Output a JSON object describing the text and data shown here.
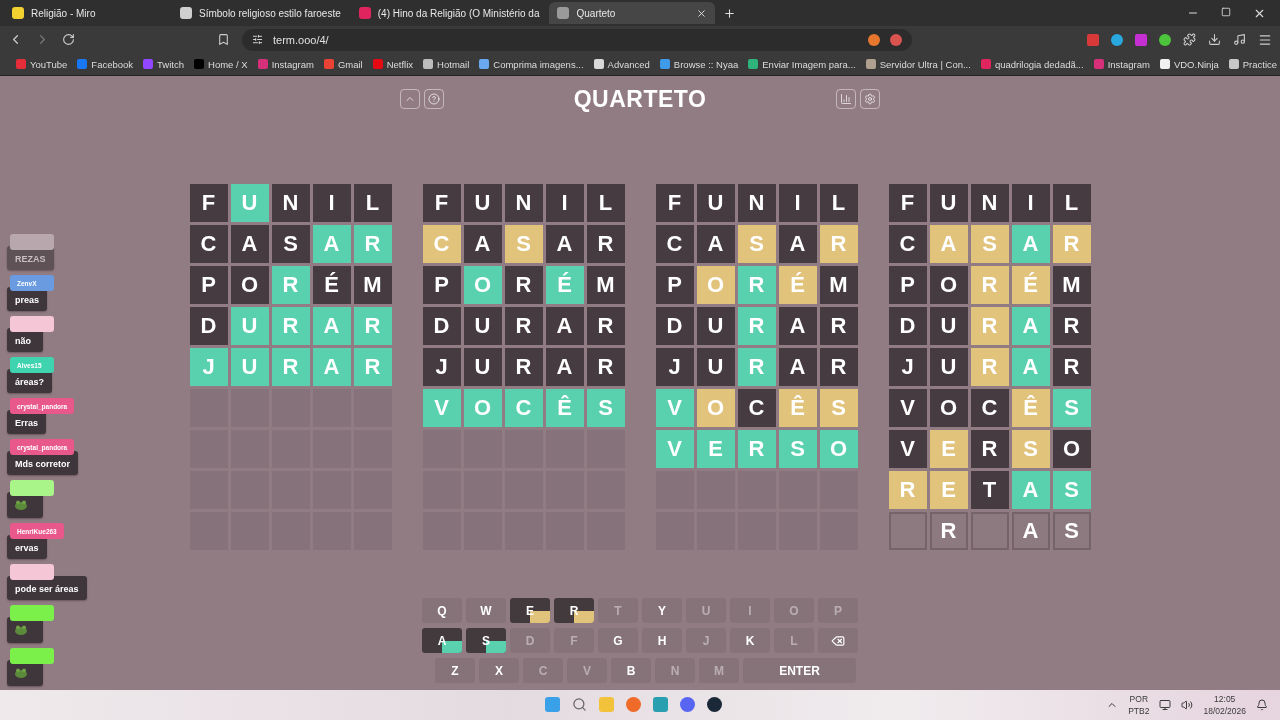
{
  "browser": {
    "tabs": [
      {
        "title": "Religião - Miro",
        "color": "#f2d230",
        "selected": false
      },
      {
        "title": "Símbolo religioso estilo faroeste",
        "color": "#cfcfcf",
        "selected": false
      },
      {
        "title": "(4) Hino da Religião (O Ministério da",
        "color": "#e0245e",
        "selected": false
      },
      {
        "title": "Quarteto",
        "color": "#9a9a9a",
        "selected": true
      }
    ],
    "address": "term.ooo/4/",
    "bookmarks": [
      {
        "label": "YouTube",
        "color": "#e52d3a"
      },
      {
        "label": "Facebook",
        "color": "#1877f2"
      },
      {
        "label": "Twitch",
        "color": "#9146ff"
      },
      {
        "label": "Home / X",
        "color": "#000000"
      },
      {
        "label": "Instagram",
        "color": "#d6307a"
      },
      {
        "label": "Gmail",
        "color": "#ea4335"
      },
      {
        "label": "Netflix",
        "color": "#e50914"
      },
      {
        "label": "Hotmail",
        "color": "#bdbdbd"
      },
      {
        "label": "Comprima imagens...",
        "color": "#6aa9f0"
      },
      {
        "label": "Advanced",
        "color": "#d9d9d9"
      },
      {
        "label": "Browse :: Nyaa",
        "color": "#3d9be9"
      },
      {
        "label": "Enviar Imagem para...",
        "color": "#2fb37a"
      },
      {
        "label": "Servidor Ultra | Con...",
        "color": "#b0a090"
      },
      {
        "label": "quadrilogia dedadã...",
        "color": "#e0245e"
      },
      {
        "label": "Instagram",
        "color": "#d6307a"
      },
      {
        "label": "VDO.Ninja",
        "color": "#f0f0f0"
      },
      {
        "label": "Practice",
        "color": "#c8c8c8"
      }
    ]
  },
  "game": {
    "title": "QUARTETO",
    "boards": [
      {
        "rows": [
          [
            {
              "letter": "F",
              "kind": "absent"
            },
            {
              "letter": "U",
              "kind": "correct"
            },
            {
              "letter": "N",
              "kind": "absent"
            },
            {
              "letter": "I",
              "kind": "absent"
            },
            {
              "letter": "L",
              "kind": "absent"
            }
          ],
          [
            {
              "letter": "C",
              "kind": "absent"
            },
            {
              "letter": "A",
              "kind": "absent"
            },
            {
              "letter": "S",
              "kind": "absent"
            },
            {
              "letter": "A",
              "kind": "correct"
            },
            {
              "letter": "R",
              "kind": "correct"
            }
          ],
          [
            {
              "letter": "P",
              "kind": "absent"
            },
            {
              "letter": "O",
              "kind": "absent"
            },
            {
              "letter": "R",
              "kind": "correct"
            },
            {
              "letter": "É",
              "kind": "absent"
            },
            {
              "letter": "M",
              "kind": "absent"
            }
          ],
          [
            {
              "letter": "D",
              "kind": "absent"
            },
            {
              "letter": "U",
              "kind": "correct"
            },
            {
              "letter": "R",
              "kind": "correct"
            },
            {
              "letter": "A",
              "kind": "correct"
            },
            {
              "letter": "R",
              "kind": "correct"
            }
          ],
          [
            {
              "letter": "J",
              "kind": "correct"
            },
            {
              "letter": "U",
              "kind": "correct"
            },
            {
              "letter": "R",
              "kind": "correct"
            },
            {
              "letter": "A",
              "kind": "correct"
            },
            {
              "letter": "R",
              "kind": "correct"
            }
          ]
        ]
      },
      {
        "rows": [
          [
            {
              "letter": "F",
              "kind": "absent"
            },
            {
              "letter": "U",
              "kind": "absent"
            },
            {
              "letter": "N",
              "kind": "absent"
            },
            {
              "letter": "I",
              "kind": "absent"
            },
            {
              "letter": "L",
              "kind": "absent"
            }
          ],
          [
            {
              "letter": "C",
              "kind": "present"
            },
            {
              "letter": "A",
              "kind": "absent"
            },
            {
              "letter": "S",
              "kind": "present"
            },
            {
              "letter": "A",
              "kind": "absent"
            },
            {
              "letter": "R",
              "kind": "absent"
            }
          ],
          [
            {
              "letter": "P",
              "kind": "absent"
            },
            {
              "letter": "O",
              "kind": "correct"
            },
            {
              "letter": "R",
              "kind": "absent"
            },
            {
              "letter": "É",
              "kind": "correct"
            },
            {
              "letter": "M",
              "kind": "absent"
            }
          ],
          [
            {
              "letter": "D",
              "kind": "absent"
            },
            {
              "letter": "U",
              "kind": "absent"
            },
            {
              "letter": "R",
              "kind": "absent"
            },
            {
              "letter": "A",
              "kind": "absent"
            },
            {
              "letter": "R",
              "kind": "absent"
            }
          ],
          [
            {
              "letter": "J",
              "kind": "absent"
            },
            {
              "letter": "U",
              "kind": "absent"
            },
            {
              "letter": "R",
              "kind": "absent"
            },
            {
              "letter": "A",
              "kind": "absent"
            },
            {
              "letter": "R",
              "kind": "absent"
            }
          ],
          [
            {
              "letter": "V",
              "kind": "correct"
            },
            {
              "letter": "O",
              "kind": "correct"
            },
            {
              "letter": "C",
              "kind": "correct"
            },
            {
              "letter": "Ê",
              "kind": "correct"
            },
            {
              "letter": "S",
              "kind": "correct"
            }
          ]
        ]
      },
      {
        "rows": [
          [
            {
              "letter": "F",
              "kind": "absent"
            },
            {
              "letter": "U",
              "kind": "absent"
            },
            {
              "letter": "N",
              "kind": "absent"
            },
            {
              "letter": "I",
              "kind": "absent"
            },
            {
              "letter": "L",
              "kind": "absent"
            }
          ],
          [
            {
              "letter": "C",
              "kind": "absent"
            },
            {
              "letter": "A",
              "kind": "absent"
            },
            {
              "letter": "S",
              "kind": "present"
            },
            {
              "letter": "A",
              "kind": "absent"
            },
            {
              "letter": "R",
              "kind": "present"
            }
          ],
          [
            {
              "letter": "P",
              "kind": "absent"
            },
            {
              "letter": "O",
              "kind": "present"
            },
            {
              "letter": "R",
              "kind": "correct"
            },
            {
              "letter": "É",
              "kind": "present"
            },
            {
              "letter": "M",
              "kind": "absent"
            }
          ],
          [
            {
              "letter": "D",
              "kind": "absent"
            },
            {
              "letter": "U",
              "kind": "absent"
            },
            {
              "letter": "R",
              "kind": "correct"
            },
            {
              "letter": "A",
              "kind": "absent"
            },
            {
              "letter": "R",
              "kind": "absent"
            }
          ],
          [
            {
              "letter": "J",
              "kind": "absent"
            },
            {
              "letter": "U",
              "kind": "absent"
            },
            {
              "letter": "R",
              "kind": "correct"
            },
            {
              "letter": "A",
              "kind": "absent"
            },
            {
              "letter": "R",
              "kind": "absent"
            }
          ],
          [
            {
              "letter": "V",
              "kind": "correct"
            },
            {
              "letter": "O",
              "kind": "present"
            },
            {
              "letter": "C",
              "kind": "absent"
            },
            {
              "letter": "Ê",
              "kind": "present"
            },
            {
              "letter": "S",
              "kind": "present"
            }
          ],
          [
            {
              "letter": "V",
              "kind": "correct"
            },
            {
              "letter": "E",
              "kind": "correct"
            },
            {
              "letter": "R",
              "kind": "correct"
            },
            {
              "letter": "S",
              "kind": "correct"
            },
            {
              "letter": "O",
              "kind": "correct"
            }
          ]
        ]
      },
      {
        "rows": [
          [
            {
              "letter": "F",
              "kind": "absent"
            },
            {
              "letter": "U",
              "kind": "absent"
            },
            {
              "letter": "N",
              "kind": "absent"
            },
            {
              "letter": "I",
              "kind": "absent"
            },
            {
              "letter": "L",
              "kind": "absent"
            }
          ],
          [
            {
              "letter": "C",
              "kind": "absent"
            },
            {
              "letter": "A",
              "kind": "present"
            },
            {
              "letter": "S",
              "kind": "present"
            },
            {
              "letter": "A",
              "kind": "correct"
            },
            {
              "letter": "R",
              "kind": "present"
            }
          ],
          [
            {
              "letter": "P",
              "kind": "absent"
            },
            {
              "letter": "O",
              "kind": "absent"
            },
            {
              "letter": "R",
              "kind": "present"
            },
            {
              "letter": "É",
              "kind": "present"
            },
            {
              "letter": "M",
              "kind": "absent"
            }
          ],
          [
            {
              "letter": "D",
              "kind": "absent"
            },
            {
              "letter": "U",
              "kind": "absent"
            },
            {
              "letter": "R",
              "kind": "present"
            },
            {
              "letter": "A",
              "kind": "correct"
            },
            {
              "letter": "R",
              "kind": "absent"
            }
          ],
          [
            {
              "letter": "J",
              "kind": "absent"
            },
            {
              "letter": "U",
              "kind": "absent"
            },
            {
              "letter": "R",
              "kind": "present"
            },
            {
              "letter": "A",
              "kind": "correct"
            },
            {
              "letter": "R",
              "kind": "absent"
            }
          ],
          [
            {
              "letter": "V",
              "kind": "absent"
            },
            {
              "letter": "O",
              "kind": "absent"
            },
            {
              "letter": "C",
              "kind": "absent"
            },
            {
              "letter": "Ê",
              "kind": "present"
            },
            {
              "letter": "S",
              "kind": "correct"
            }
          ],
          [
            {
              "letter": "V",
              "kind": "absent"
            },
            {
              "letter": "E",
              "kind": "present"
            },
            {
              "letter": "R",
              "kind": "absent"
            },
            {
              "letter": "S",
              "kind": "present"
            },
            {
              "letter": "O",
              "kind": "absent"
            }
          ],
          [
            {
              "letter": "R",
              "kind": "present"
            },
            {
              "letter": "E",
              "kind": "present"
            },
            {
              "letter": "T",
              "kind": "absent"
            },
            {
              "letter": "A",
              "kind": "correct"
            },
            {
              "letter": "S",
              "kind": "correct"
            }
          ],
          [
            {
              "kind": "typing"
            },
            {
              "letter": "R",
              "kind": "typing"
            },
            {
              "kind": "typing"
            },
            {
              "letter": "A",
              "kind": "typing"
            },
            {
              "letter": "S",
              "kind": "typing"
            }
          ]
        ]
      }
    ],
    "keyboard": [
      [
        {
          "kind": "letter",
          "label": "Q",
          "faded": false,
          "used": false
        },
        {
          "kind": "letter",
          "label": "W",
          "faded": false,
          "used": false
        },
        {
          "kind": "letter",
          "label": "E",
          "faded": false,
          "used": true,
          "color": "#e2c37c"
        },
        {
          "kind": "letter",
          "label": "R",
          "faded": false,
          "used": true,
          "color": "#e2c37c"
        },
        {
          "kind": "letter",
          "label": "T",
          "faded": true,
          "used": false
        },
        {
          "kind": "letter",
          "label": "Y",
          "faded": false,
          "used": false
        },
        {
          "kind": "letter",
          "label": "U",
          "faded": true,
          "used": false
        },
        {
          "kind": "letter",
          "label": "I",
          "faded": true,
          "used": false
        },
        {
          "kind": "letter",
          "label": "O",
          "faded": true,
          "used": false
        },
        {
          "kind": "letter",
          "label": "P",
          "faded": true,
          "used": false
        }
      ],
      [
        {
          "kind": "letter",
          "label": "A",
          "faded": false,
          "used": true,
          "color": "#59d1ae"
        },
        {
          "kind": "letter",
          "label": "S",
          "faded": false,
          "used": true,
          "color": "#59d1ae"
        },
        {
          "kind": "letter",
          "label": "D",
          "faded": true,
          "used": false
        },
        {
          "kind": "letter",
          "label": "F",
          "faded": true,
          "used": false
        },
        {
          "kind": "letter",
          "label": "G",
          "faded": false,
          "used": false
        },
        {
          "kind": "letter",
          "label": "H",
          "faded": false,
          "used": false
        },
        {
          "kind": "letter",
          "label": "J",
          "faded": true,
          "used": false
        },
        {
          "kind": "letter",
          "label": "K",
          "faded": false,
          "used": false
        },
        {
          "kind": "letter",
          "label": "L",
          "faded": true,
          "used": false
        },
        {
          "kind": "backspace"
        }
      ],
      [
        {
          "kind": "letter",
          "label": "Z",
          "faded": false,
          "used": false
        },
        {
          "kind": "letter",
          "label": "X",
          "faded": false,
          "used": false
        },
        {
          "kind": "letter",
          "label": "C",
          "faded": true,
          "used": false
        },
        {
          "kind": "letter",
          "label": "V",
          "faded": true,
          "used": false
        },
        {
          "kind": "letter",
          "label": "B",
          "faded": false,
          "used": false
        },
        {
          "kind": "letter",
          "label": "N",
          "faded": true,
          "used": false
        },
        {
          "kind": "letter",
          "label": "M",
          "faded": true,
          "used": false
        },
        {
          "kind": "enter",
          "label": "ENTER"
        }
      ]
    ]
  },
  "chat": [
    {
      "kind": "text",
      "color": "#b8a8ad",
      "text": "REZAS",
      "dimmed": true
    },
    {
      "kind": "text",
      "user": "ZenvX",
      "color": "#6a9be0",
      "text": "preas",
      "dimmed": false
    },
    {
      "kind": "text",
      "color": "#f4c6d6",
      "text": "não",
      "dimmed": false
    },
    {
      "kind": "text",
      "user": "Alves15",
      "color": "#3fd3b0",
      "text": "áreas?",
      "dimmed": false
    },
    {
      "kind": "text",
      "user": "crystal_pandora",
      "color": "#e8588a",
      "text": "Erras",
      "dimmed": false
    },
    {
      "kind": "text",
      "user": "crystal_pandora",
      "color": "#e8588a",
      "text": "Mds corretor",
      "dimmed": false
    },
    {
      "kind": "emote",
      "color": "#a9f58a"
    },
    {
      "kind": "text",
      "user": "HenriKue263",
      "color": "#e8588a",
      "text": "ervas",
      "dimmed": false
    },
    {
      "kind": "text",
      "color": "#f4c6d6",
      "text": "pode ser áreas",
      "dimmed": false
    },
    {
      "kind": "emote",
      "color": "#7cf04a"
    },
    {
      "kind": "emote",
      "color": "#7cf04a"
    }
  ],
  "taskbar": {
    "language": "POR",
    "layout": "PTB2",
    "time": "12:05",
    "date": "18/02/2026"
  }
}
